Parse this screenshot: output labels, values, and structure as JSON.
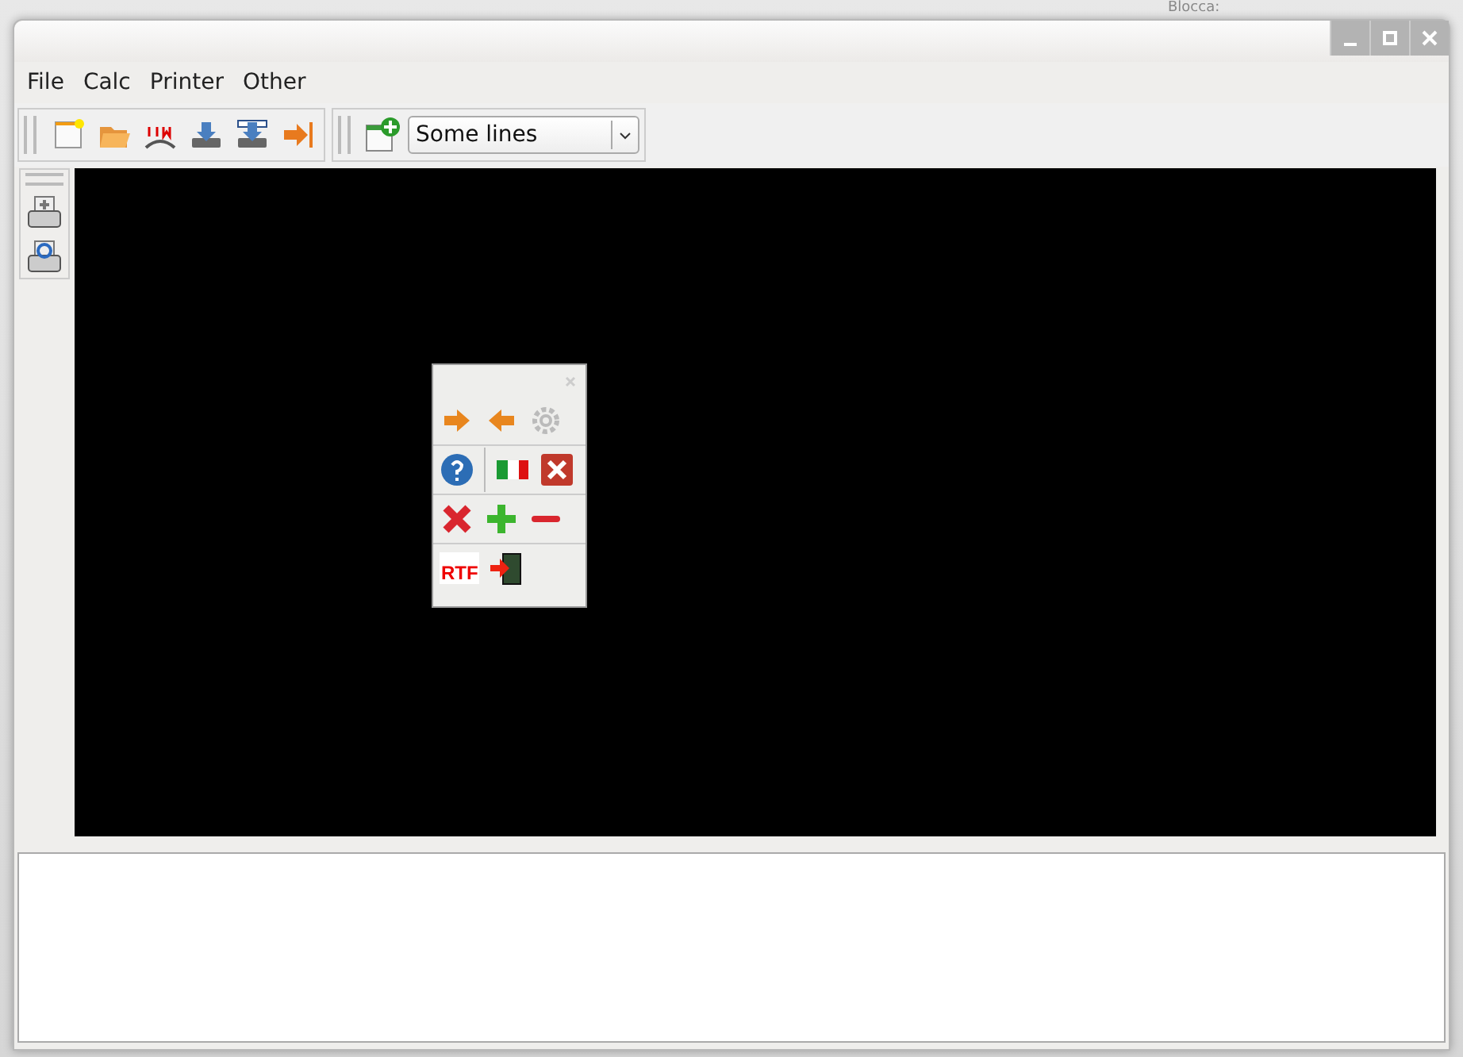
{
  "background": {
    "label": "Blocca:"
  },
  "menu": [
    "File",
    "Calc",
    "Printer",
    "Other"
  ],
  "toolbar": {
    "dropdown": {
      "value": "Some lines"
    }
  },
  "palette": {
    "rtf_label": "RTF"
  }
}
